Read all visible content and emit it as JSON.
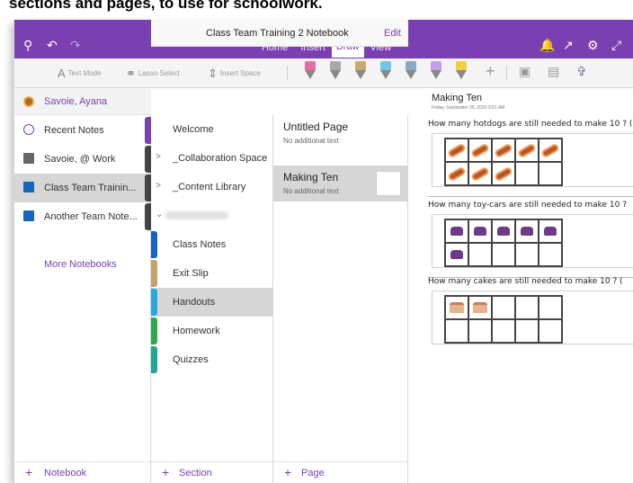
{
  "caption": "sections and pages, to use for schoolwork.",
  "titlebar": {
    "title": "Class Team Training 2 Notebook",
    "tabs": [
      {
        "label": "Home",
        "active": false
      },
      {
        "label": "Insert",
        "active": false
      },
      {
        "label": "Draw",
        "active": true
      },
      {
        "label": "View",
        "active": false
      }
    ],
    "notification_count": "!",
    "accent": "#7a3fb0"
  },
  "ribbon": {
    "text_mode": "Text Mode",
    "lasso_select": "Lasso Select",
    "insert_space": "Insert Space",
    "pens": [
      {
        "color": "#e86aa7"
      },
      {
        "color": "#a8a8a8"
      },
      {
        "color": "#c9a96e"
      },
      {
        "color": "#6fc6e8"
      },
      {
        "color": "#8aa8c8"
      },
      {
        "color": "#c79bef"
      },
      {
        "color": "#f0d040"
      }
    ]
  },
  "notebooks": {
    "user": "Savoie, Ayana",
    "items": [
      {
        "label": "Recent Notes",
        "icon": "clock-icon",
        "tab_color": "#7a3fb0"
      },
      {
        "label": "Savoie, @ Work",
        "icon": "notebook-icon",
        "tab_color": "#444444"
      },
      {
        "label": "Class Team Trainin...",
        "icon": "notebook-icon",
        "tab_color": "#444444",
        "selected": true
      },
      {
        "label": "Another Team Note...",
        "icon": "notebook-icon",
        "tab_color": "#444444"
      }
    ],
    "more": "More Notebooks",
    "add": "Notebook"
  },
  "header": {
    "notebook_title": "Class Team Training 2 Notebook",
    "edit": "Edit"
  },
  "sections": {
    "items": [
      {
        "label": "Welcome",
        "chevron": "",
        "color": ""
      },
      {
        "label": "_Collaboration Space",
        "chevron": ">",
        "color": ""
      },
      {
        "label": "_Content Library",
        "chevron": ">",
        "color": ""
      },
      {
        "label": "",
        "chevron": "⌄",
        "color": "",
        "blurred": true
      },
      {
        "label": "Class Notes",
        "chevron": "",
        "color": "#1565c0"
      },
      {
        "label": "Exit Slip",
        "chevron": "",
        "color": "#c8a06a"
      },
      {
        "label": "Handouts",
        "chevron": "",
        "color": "#29a8e0",
        "selected": true
      },
      {
        "label": "Homework",
        "chevron": "",
        "color": "#2eaa4a"
      },
      {
        "label": "Quizzes",
        "chevron": "",
        "color": "#1fa89a"
      }
    ],
    "add": "Section"
  },
  "pages": {
    "items": [
      {
        "title": "Untitled Page",
        "subtitle": "No additional text"
      },
      {
        "title": "Making Ten",
        "subtitle": "No additional text",
        "selected": true
      }
    ],
    "add": "Page"
  },
  "canvas": {
    "title": "Making Ten",
    "date": "Friday, September 25, 2020     9:51 AM",
    "questions": [
      {
        "text": "How many hotdogs are still needed to make 10 ?  (",
        "item": "hotdog",
        "filled": 8,
        "answer_colors": [
          "#29a8e0",
          "#29a8e0"
        ]
      },
      {
        "text": "How many toy-cars are still needed to make 10 ?",
        "item": "car",
        "filled": 6,
        "answer_colors": [
          "#e0407a",
          "#e0407a"
        ]
      },
      {
        "text": "How many cakes are still needed to make 10 ? (",
        "item": "cake",
        "filled": 2,
        "answer_colors": [
          "#2eaa4a",
          "#2eaa4a"
        ]
      }
    ]
  }
}
